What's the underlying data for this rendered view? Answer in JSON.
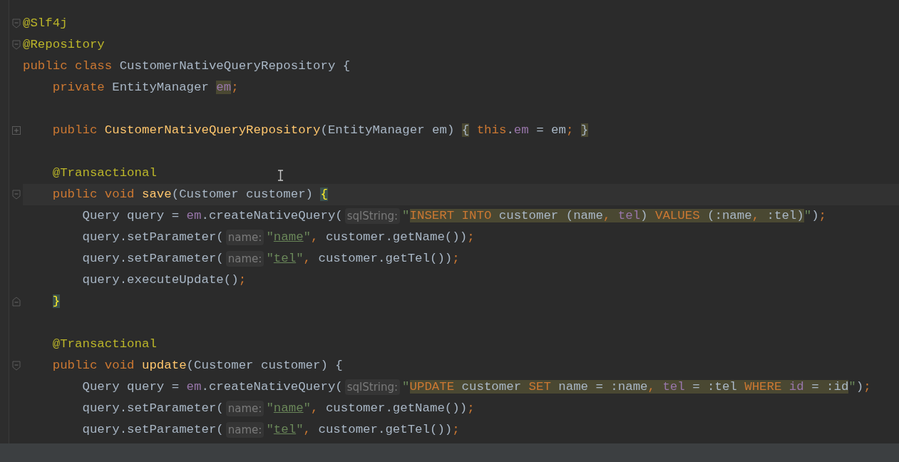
{
  "editor": {
    "lines": [
      {
        "kind": "code",
        "gutter": {
          "kind": "fold-start"
        },
        "tokens": [
          {
            "text": "@Slf4j",
            "kind": "annotation"
          }
        ]
      },
      {
        "kind": "code",
        "gutter": {
          "kind": "fold-start"
        },
        "tokens": [
          {
            "text": "@Repository",
            "kind": "annotation"
          }
        ]
      },
      {
        "kind": "code",
        "tokens": [
          {
            "text": "public class ",
            "kind": "keyword"
          },
          {
            "text": "CustomerNativeQueryRepository {",
            "kind": "plain"
          }
        ]
      },
      {
        "kind": "code",
        "tokens": [
          {
            "text": "    private ",
            "kind": "keyword"
          },
          {
            "text": "EntityManager ",
            "kind": "plain"
          },
          {
            "text": "em",
            "kind": "field",
            "highlight": true
          },
          {
            "text": ";",
            "kind": "punct"
          }
        ]
      },
      {
        "kind": "blank"
      },
      {
        "kind": "code",
        "gutter": {
          "kind": "fold-collapsed"
        },
        "tokens": [
          {
            "text": "    public ",
            "kind": "keyword"
          },
          {
            "text": "CustomerNativeQueryRepository",
            "kind": "method"
          },
          {
            "text": "(EntityManager em) ",
            "kind": "plain"
          },
          {
            "text": "{",
            "kind": "plain",
            "highlight": true
          },
          {
            "text": " this",
            "kind": "keyword"
          },
          {
            "text": ".",
            "kind": "plain"
          },
          {
            "text": "em",
            "kind": "field"
          },
          {
            "text": " = em",
            "kind": "plain"
          },
          {
            "text": "; ",
            "kind": "punct"
          },
          {
            "text": "}",
            "kind": "plain",
            "highlight": true
          }
        ]
      },
      {
        "kind": "blank"
      },
      {
        "kind": "code",
        "tokens": [
          {
            "text": "    @Transactional",
            "kind": "annotation"
          }
        ]
      },
      {
        "kind": "code",
        "gutter": {
          "kind": "fold-start"
        },
        "current": true,
        "tokens": [
          {
            "text": "    public void ",
            "kind": "keyword"
          },
          {
            "text": "save",
            "kind": "method"
          },
          {
            "text": "(Customer customer) ",
            "kind": "plain"
          },
          {
            "text": "{",
            "kind": "brace",
            "highlight": true
          }
        ]
      },
      {
        "kind": "code",
        "tokens": [
          {
            "text": "        Query query = ",
            "kind": "plain"
          },
          {
            "text": "em",
            "kind": "field"
          },
          {
            "text": ".createNativeQuery(",
            "kind": "plain"
          },
          {
            "text": "sqlString:",
            "kind": "hint"
          },
          {
            "text": "\"",
            "kind": "string"
          },
          {
            "text": "INSERT INTO ",
            "kind": "sql-keyword",
            "highlight": true
          },
          {
            "text": "customer (name",
            "kind": "plain",
            "highlight": true
          },
          {
            "text": ", ",
            "kind": "punct",
            "highlight": true
          },
          {
            "text": "tel",
            "kind": "field",
            "highlight": true
          },
          {
            "text": ") ",
            "kind": "plain",
            "highlight": true
          },
          {
            "text": "VALUES ",
            "kind": "sql-keyword",
            "highlight": true
          },
          {
            "text": "(:name",
            "kind": "plain",
            "highlight": true
          },
          {
            "text": ", ",
            "kind": "punct",
            "highlight": true
          },
          {
            "text": ":tel)",
            "kind": "plain",
            "highlight": true
          },
          {
            "text": "\"",
            "kind": "string"
          },
          {
            "text": ")",
            "kind": "plain"
          },
          {
            "text": ";",
            "kind": "punct"
          }
        ]
      },
      {
        "kind": "code",
        "tokens": [
          {
            "text": "        query.setParameter(",
            "kind": "plain"
          },
          {
            "text": "name:",
            "kind": "hint"
          },
          {
            "text": "\"",
            "kind": "string"
          },
          {
            "text": "name",
            "kind": "string-ref"
          },
          {
            "text": "\"",
            "kind": "string"
          },
          {
            "text": ", ",
            "kind": "punct"
          },
          {
            "text": "customer.getName())",
            "kind": "plain"
          },
          {
            "text": ";",
            "kind": "punct"
          }
        ]
      },
      {
        "kind": "code",
        "tokens": [
          {
            "text": "        query.setParameter(",
            "kind": "plain"
          },
          {
            "text": "name:",
            "kind": "hint"
          },
          {
            "text": "\"",
            "kind": "string"
          },
          {
            "text": "tel",
            "kind": "string-ref"
          },
          {
            "text": "\"",
            "kind": "string"
          },
          {
            "text": ", ",
            "kind": "punct"
          },
          {
            "text": "customer.getTel())",
            "kind": "plain"
          },
          {
            "text": ";",
            "kind": "punct"
          }
        ]
      },
      {
        "kind": "code",
        "tokens": [
          {
            "text": "        query.executeUpdate()",
            "kind": "plain"
          },
          {
            "text": ";",
            "kind": "punct"
          }
        ]
      },
      {
        "kind": "code",
        "gutter": {
          "kind": "fold-end"
        },
        "tokens": [
          {
            "text": "    }",
            "kind": "brace",
            "highlight": true
          }
        ]
      },
      {
        "kind": "blank"
      },
      {
        "kind": "code",
        "tokens": [
          {
            "text": "    @Transactional",
            "kind": "annotation"
          }
        ]
      },
      {
        "kind": "code",
        "gutter": {
          "kind": "fold-start"
        },
        "tokens": [
          {
            "text": "    public void ",
            "kind": "keyword"
          },
          {
            "text": "update",
            "kind": "method"
          },
          {
            "text": "(Customer customer) {",
            "kind": "plain"
          }
        ]
      },
      {
        "kind": "code",
        "tokens": [
          {
            "text": "        Query query = ",
            "kind": "plain"
          },
          {
            "text": "em",
            "kind": "field"
          },
          {
            "text": ".createNativeQuery(",
            "kind": "plain"
          },
          {
            "text": "sqlString:",
            "kind": "hint"
          },
          {
            "text": "\"",
            "kind": "string"
          },
          {
            "text": "UPDATE ",
            "kind": "sql-keyword",
            "highlight": true
          },
          {
            "text": "customer ",
            "kind": "plain",
            "highlight": true
          },
          {
            "text": "SET ",
            "kind": "sql-keyword",
            "highlight": true
          },
          {
            "text": "name = :name",
            "kind": "plain",
            "highlight": true
          },
          {
            "text": ", ",
            "kind": "punct",
            "highlight": true
          },
          {
            "text": "tel",
            "kind": "field",
            "highlight": true
          },
          {
            "text": " = :tel ",
            "kind": "plain",
            "highlight": true
          },
          {
            "text": "WHERE ",
            "kind": "sql-keyword",
            "highlight": true
          },
          {
            "text": "id",
            "kind": "field",
            "highlight": true
          },
          {
            "text": " = :id",
            "kind": "plain",
            "highlight": true
          },
          {
            "text": "\"",
            "kind": "string"
          },
          {
            "text": ")",
            "kind": "plain"
          },
          {
            "text": ";",
            "kind": "punct"
          }
        ]
      },
      {
        "kind": "code",
        "tokens": [
          {
            "text": "        query.setParameter(",
            "kind": "plain"
          },
          {
            "text": "name:",
            "kind": "hint"
          },
          {
            "text": "\"",
            "kind": "string"
          },
          {
            "text": "name",
            "kind": "string-ref"
          },
          {
            "text": "\"",
            "kind": "string"
          },
          {
            "text": ", ",
            "kind": "punct"
          },
          {
            "text": "customer.getName())",
            "kind": "plain"
          },
          {
            "text": ";",
            "kind": "punct"
          }
        ]
      },
      {
        "kind": "code",
        "tokens": [
          {
            "text": "        query.setParameter(",
            "kind": "plain"
          },
          {
            "text": "name:",
            "kind": "hint"
          },
          {
            "text": "\"",
            "kind": "string"
          },
          {
            "text": "tel",
            "kind": "string-ref"
          },
          {
            "text": "\"",
            "kind": "string"
          },
          {
            "text": ", ",
            "kind": "punct"
          },
          {
            "text": "customer.getTel())",
            "kind": "plain"
          },
          {
            "text": ";",
            "kind": "punct"
          }
        ]
      }
    ]
  }
}
